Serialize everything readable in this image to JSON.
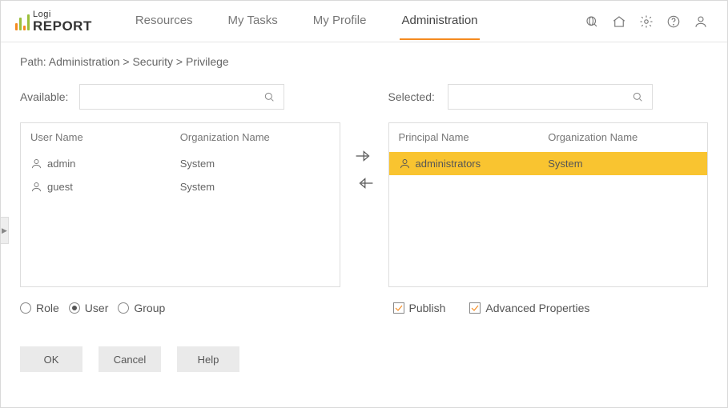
{
  "logo": {
    "top": "Logi",
    "bottom": "REPORT"
  },
  "nav": {
    "items": [
      {
        "label": "Resources",
        "active": false
      },
      {
        "label": "My Tasks",
        "active": false
      },
      {
        "label": "My Profile",
        "active": false
      },
      {
        "label": "Administration",
        "active": true
      }
    ]
  },
  "breadcrumb": "Path: Administration > Security > Privilege",
  "available": {
    "label": "Available:",
    "headers": {
      "a": "User Name",
      "b": "Organization Name"
    },
    "rows": [
      {
        "name": "admin",
        "org": "System",
        "highlight": false
      },
      {
        "name": "guest",
        "org": "System",
        "highlight": false
      }
    ]
  },
  "selected": {
    "label": "Selected:",
    "headers": {
      "a": "Principal Name",
      "b": "Organization Name"
    },
    "rows": [
      {
        "name": "administrators",
        "org": "System",
        "highlight": true
      }
    ]
  },
  "radios": [
    {
      "label": "Role",
      "active": false
    },
    {
      "label": "User",
      "active": true
    },
    {
      "label": "Group",
      "active": false
    }
  ],
  "checks": [
    {
      "label": "Publish",
      "checked": true
    },
    {
      "label": "Advanced Properties",
      "checked": true
    }
  ],
  "buttons": {
    "ok": "OK",
    "cancel": "Cancel",
    "help": "Help"
  }
}
